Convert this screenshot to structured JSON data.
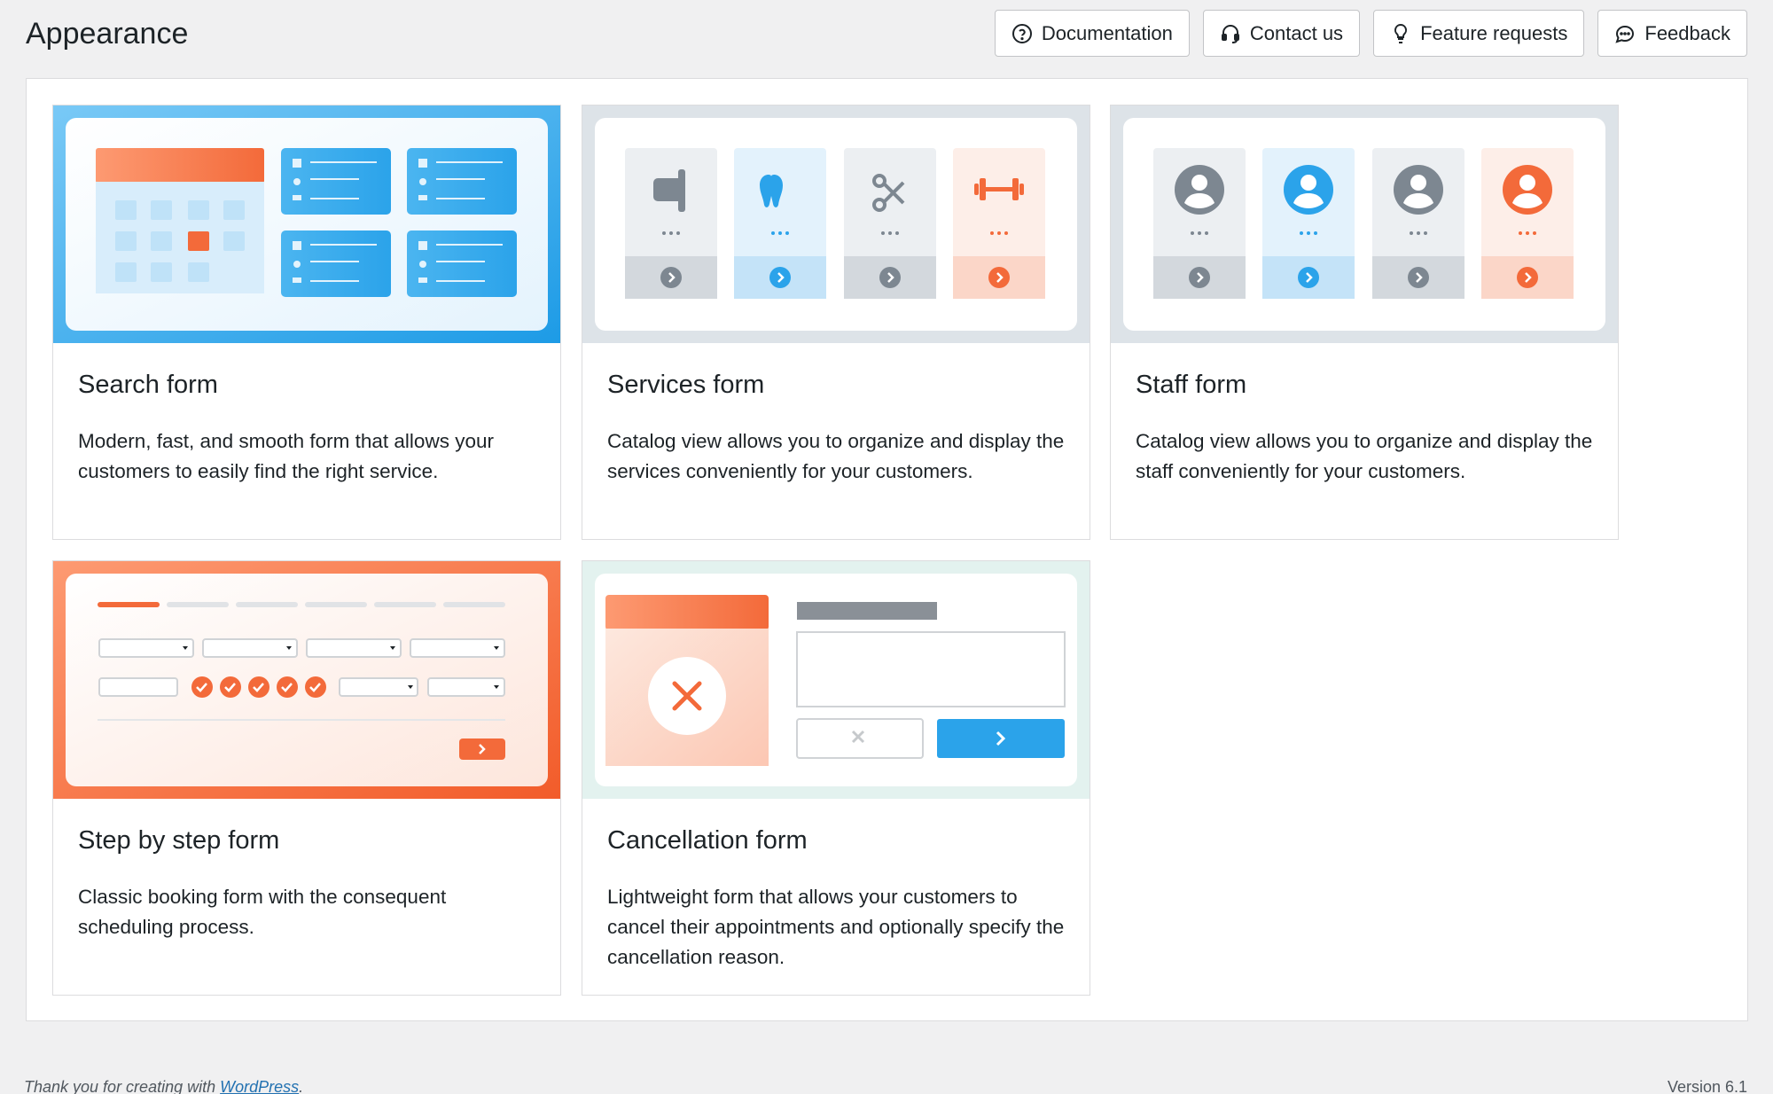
{
  "page": {
    "title": "Appearance"
  },
  "header_buttons": [
    {
      "label": "Documentation",
      "icon": "question-circle-icon"
    },
    {
      "label": "Contact us",
      "icon": "headset-icon"
    },
    {
      "label": "Feature requests",
      "icon": "lightbulb-icon"
    },
    {
      "label": "Feedback",
      "icon": "chat-bubble-icon"
    }
  ],
  "cards": [
    {
      "title": "Search form",
      "description": "Modern, fast, and smooth form that allows your customers to easily find the right service."
    },
    {
      "title": "Services form",
      "description": "Catalog view allows you to organize and display the services conveniently for your customers."
    },
    {
      "title": "Staff form",
      "description": "Catalog view allows you to organize and display the staff conveniently for your customers."
    },
    {
      "title": "Step by step form",
      "description": "Classic booking form with the consequent scheduling process."
    },
    {
      "title": "Cancellation form",
      "description": "Lightweight form that allows your customers to cancel their appointments and optionally specify the cancellation reason."
    }
  ],
  "footer": {
    "thanks_prefix": "Thank you for creating with",
    "wordpress_link": "WordPress",
    "thanks_suffix": ".",
    "version": "Version 6.1"
  },
  "colors": {
    "blue": "#2ba3ea",
    "orange": "#f36a3a",
    "gray": "#7d8791"
  }
}
